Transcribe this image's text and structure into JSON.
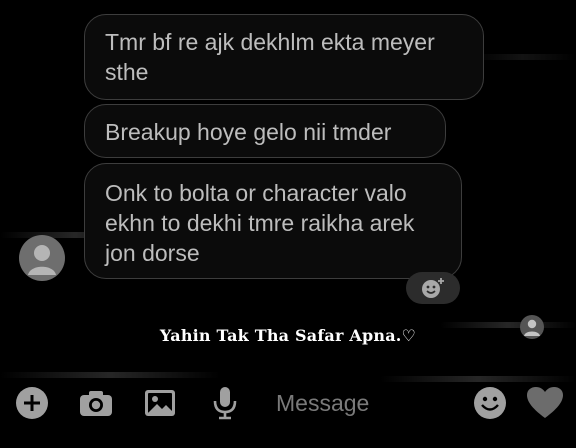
{
  "messages": [
    {
      "text": "Tmr bf re ajk dekhlm ekta meyer sthe"
    },
    {
      "text": "Breakup hoye gelo nii tmder"
    },
    {
      "text": "Onk to bolta or character  valo ekhn to dekhi tmre raikha arek jon dorse"
    }
  ],
  "caption": {
    "text": "Yahin Tak Tha Safar Apna.♡"
  },
  "composer": {
    "placeholder": "Message",
    "icons": [
      "plus-icon",
      "camera-icon",
      "image-icon",
      "microphone-icon",
      "smiley-icon",
      "heart-icon"
    ]
  },
  "colors": {
    "background": "#000000",
    "bubble_border": "#3d3d3d",
    "bubble_text": "#bdbdbd",
    "icon": "#9a9a9a"
  }
}
